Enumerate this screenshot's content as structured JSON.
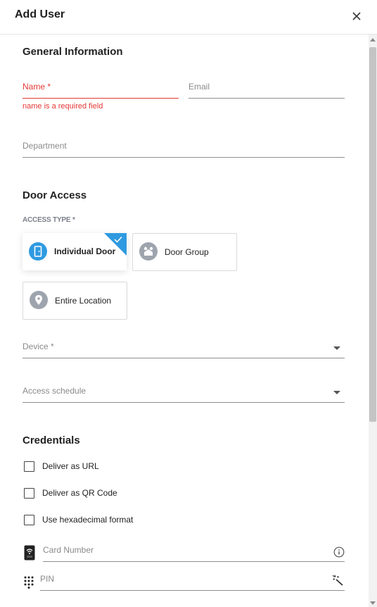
{
  "dialog": {
    "title": "Add User"
  },
  "general": {
    "title": "General Information",
    "name_label": "Name *",
    "name_error": "name is a required field",
    "email_label": "Email",
    "department_label": "Department"
  },
  "door_access": {
    "title": "Door Access",
    "access_type_label": "ACCESS TYPE *",
    "options": [
      {
        "label": "Individual Door",
        "selected": true
      },
      {
        "label": "Door Group",
        "selected": false
      },
      {
        "label": "Entire Location",
        "selected": false
      }
    ],
    "device_label": "Device *",
    "schedule_label": "Access schedule"
  },
  "credentials": {
    "title": "Credentials",
    "checkboxes": [
      {
        "label": "Deliver as URL",
        "checked": false
      },
      {
        "label": "Deliver as QR Code",
        "checked": false
      },
      {
        "label": "Use hexadecimal format",
        "checked": false
      }
    ],
    "card_number_label": "Card Number",
    "pin_label": "PIN"
  },
  "colors": {
    "accent": "#2f9ae0",
    "error": "#e53935",
    "icon_gray": "#9ea4ad"
  },
  "icons": {
    "close": "close-icon",
    "door": "door-icon",
    "door_group": "door-group-icon",
    "location": "location-pin-icon",
    "card_reader": "card-reader-icon",
    "info": "info-icon",
    "keypad": "keypad-icon",
    "magic_wand": "magic-wand-icon"
  }
}
